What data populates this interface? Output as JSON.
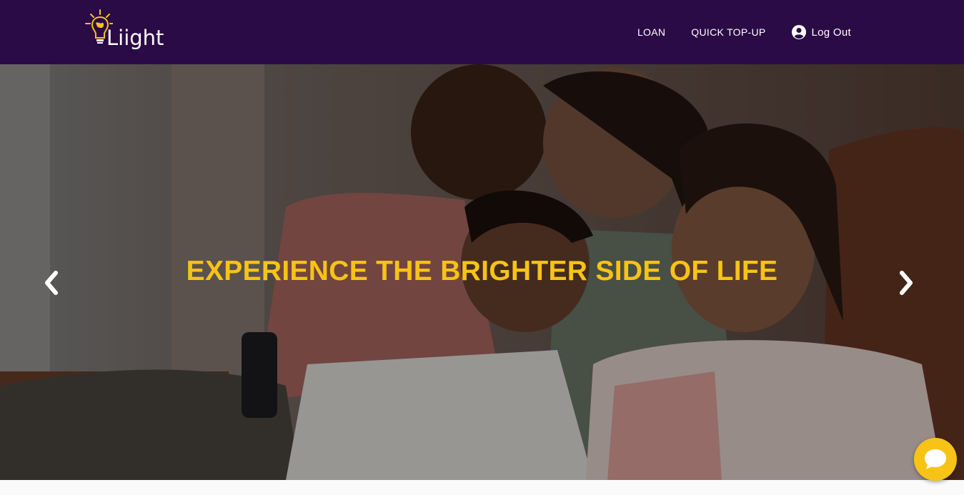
{
  "brand": {
    "name": "Liight",
    "icon": "lightbulb-globe-icon",
    "colors": {
      "nav_bg": "#2b0b46",
      "accent": "#f7c316"
    }
  },
  "nav": {
    "items": [
      {
        "label": "LOAN"
      },
      {
        "label": "QUICK TOP-UP"
      }
    ],
    "logout": {
      "label": "Log Out",
      "icon": "user-circle-icon"
    }
  },
  "hero": {
    "title": "EXPERIENCE THE BRIGHTER SIDE OF LIFE",
    "prev_icon": "chevron-left-icon",
    "next_icon": "chevron-right-icon"
  },
  "chat": {
    "icon": "chat-bubble-icon"
  }
}
